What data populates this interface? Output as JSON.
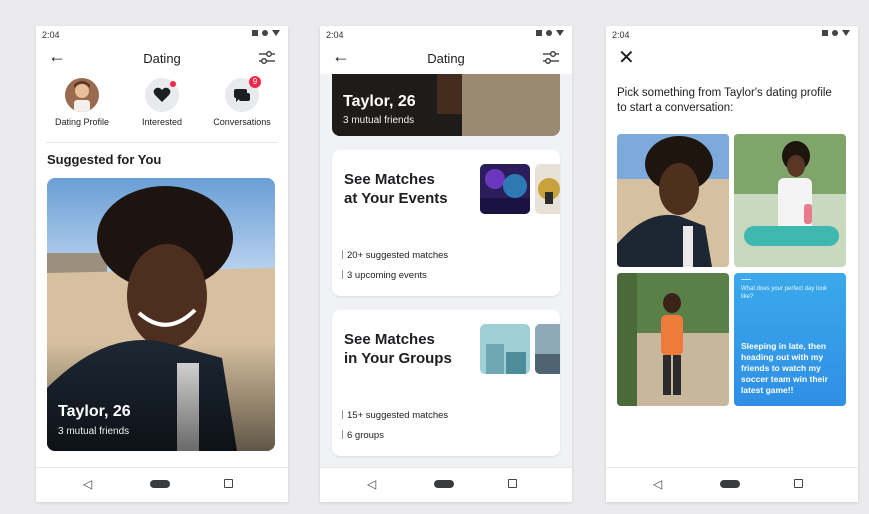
{
  "screens": [
    {
      "status_time": "2:04",
      "title": "Dating",
      "shortcuts": [
        {
          "label": "Dating Profile",
          "icon": "avatar"
        },
        {
          "label": "Interested",
          "icon": "heart-icon"
        },
        {
          "label": "Conversations",
          "icon": "chat-icon",
          "badge": "9"
        }
      ],
      "section_title": "Suggested for You",
      "card": {
        "name": "Taylor, 26",
        "subtitle": "3 mutual friends"
      }
    },
    {
      "status_time": "2:04",
      "title": "Dating",
      "top_card": {
        "name": "Taylor, 26",
        "subtitle": "3 mutual friends"
      },
      "cards": [
        {
          "title_line1": "See Matches",
          "title_line2": "at Your Events",
          "stats": [
            "20+ suggested matches",
            "3 upcoming events"
          ]
        },
        {
          "title_line1": "See Matches",
          "title_line2": "in Your Groups",
          "stats": [
            "15+ suggested matches",
            "6 groups"
          ]
        }
      ]
    },
    {
      "status_time": "2:04",
      "prompt": "Pick something from Taylor's dating profile to start a conversation:",
      "question": "What does your perfect day look like?",
      "answer": "Sleeping in late, then heading out with my friends to watch my soccer team win their latest game!!"
    }
  ],
  "colors": {
    "accent_blue": "#3b9de6",
    "badge_red": "#f02849"
  }
}
